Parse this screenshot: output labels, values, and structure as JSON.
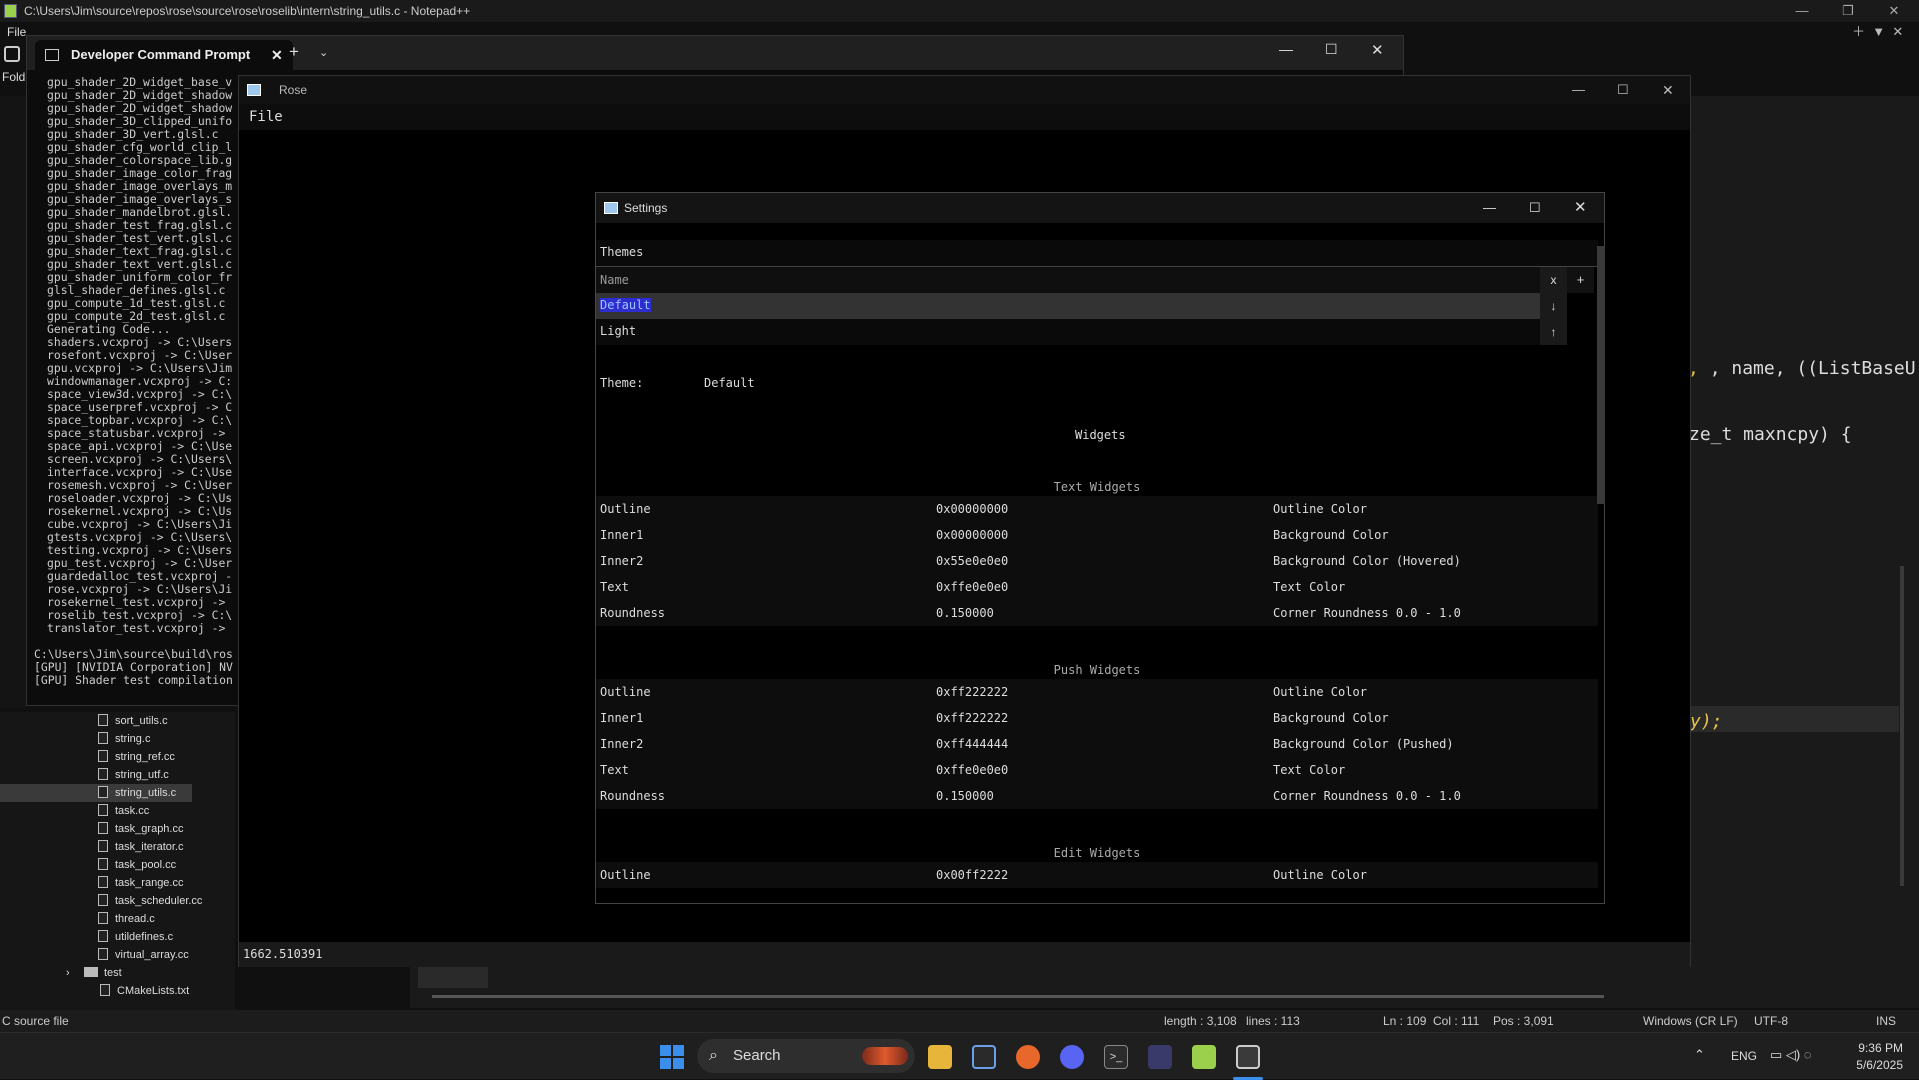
{
  "npp": {
    "title": "C:\\Users\\Jim\\source\\repos\\rose\\source\\rose\\roselib\\intern\\string_utils.c - Notepad++",
    "menu_file": "File",
    "folder_label": "Fold",
    "tree_items": [
      {
        "label": "sort_utils.c",
        "selected": false
      },
      {
        "label": "string.c",
        "selected": false
      },
      {
        "label": "string_ref.cc",
        "selected": false
      },
      {
        "label": "string_utf.c",
        "selected": false
      },
      {
        "label": "string_utils.c",
        "selected": true
      },
      {
        "label": "task.cc",
        "selected": false
      },
      {
        "label": "task_graph.cc",
        "selected": false
      },
      {
        "label": "task_iterator.c",
        "selected": false
      },
      {
        "label": "task_pool.cc",
        "selected": false
      },
      {
        "label": "task_range.cc",
        "selected": false
      },
      {
        "label": "task_scheduler.cc",
        "selected": false
      },
      {
        "label": "thread.c",
        "selected": false
      },
      {
        "label": "utildefines.c",
        "selected": false
      },
      {
        "label": "virtual_array.cc",
        "selected": false
      }
    ],
    "tree_folder": "test",
    "tree_cmake": "CMakeLists.txt",
    "code_line1": ", name, ((ListBaseU",
    "code_line2": "ze_t maxncpy) {",
    "code_line3": "y);",
    "status": {
      "file_type": "C source file",
      "length": "length : 3,108",
      "lines": "lines : 113",
      "ln": "Ln : 109",
      "col": "Col : 111",
      "pos": "Pos : 3,091",
      "eol": "Windows (CR LF)",
      "encoding": "UTF-8",
      "mode": "INS"
    }
  },
  "terminal": {
    "tab_title": "Developer Command Prompt",
    "lines": [
      "gpu_shader_2D_widget_base_v",
      "gpu_shader_2D_widget_shadow",
      "gpu_shader_2D_widget_shadow",
      "gpu_shader_3D_clipped_unifo",
      "gpu_shader_3D_vert.glsl.c",
      "gpu_shader_cfg_world_clip_l",
      "gpu_shader_colorspace_lib.g",
      "gpu_shader_image_color_frag",
      "gpu_shader_image_overlays_m",
      "gpu_shader_image_overlays_s",
      "gpu_shader_mandelbrot.glsl.",
      "gpu_shader_test_frag.glsl.c",
      "gpu_shader_test_vert.glsl.c",
      "gpu_shader_text_frag.glsl.c",
      "gpu_shader_text_vert.glsl.c",
      "gpu_shader_uniform_color_fr",
      "glsl_shader_defines.glsl.c",
      "gpu_compute_1d_test.glsl.c",
      "gpu_compute_2d_test.glsl.c",
      "Generating Code...",
      "shaders.vcxproj -> C:\\Users",
      "rosefont.vcxproj -> C:\\User",
      "gpu.vcxproj -> C:\\Users\\Jim",
      "windowmanager.vcxproj -> C:",
      "space_view3d.vcxproj -> C:\\",
      "space_userpref.vcxproj -> C",
      "space_topbar.vcxproj -> C:\\",
      "space_statusbar.vcxproj ->",
      "space_api.vcxproj -> C:\\Use",
      "screen.vcxproj -> C:\\Users\\",
      "interface.vcxproj -> C:\\Use",
      "rosemesh.vcxproj -> C:\\User",
      "roseloader.vcxproj -> C:\\Us",
      "rosekernel.vcxproj -> C:\\Us",
      "cube.vcxproj -> C:\\Users\\Ji",
      "gtests.vcxproj -> C:\\Users\\",
      "testing.vcxproj -> C:\\Users",
      "gpu_test.vcxproj -> C:\\User",
      "guardedalloc_test.vcxproj -",
      "rose.vcxproj -> C:\\Users\\Ji",
      "rosekernel_test.vcxproj ->",
      "roselib_test.vcxproj -> C:\\",
      "translator_test.vcxproj ->"
    ],
    "footer_lines": [
      "C:\\Users\\Jim\\source\\build\\ros",
      "[GPU] [NVIDIA Corporation] NV",
      "[GPU] Shader test compilation"
    ]
  },
  "rose": {
    "title": "Rose",
    "menu_file": "File",
    "status_value": "1662.510391"
  },
  "settings": {
    "title": "Settings",
    "themes_header": "Themes",
    "name_header": "Name",
    "btn_remove": "x",
    "btn_add": "+",
    "btn_down": "↓",
    "btn_up": "↑",
    "theme_list": [
      "Default",
      "Light"
    ],
    "theme_label": "Theme:",
    "theme_value": "Default",
    "widgets_header": "Widgets",
    "sections": [
      {
        "title": "Text Widgets",
        "rows": [
          {
            "name": "Outline",
            "value": "0x00000000",
            "desc": "Outline Color"
          },
          {
            "name": "Inner1",
            "value": "0x00000000",
            "desc": "Background Color"
          },
          {
            "name": "Inner2",
            "value": "0x55e0e0e0",
            "desc": "Background Color (Hovered)"
          },
          {
            "name": "Text",
            "value": "0xffe0e0e0",
            "desc": "Text Color"
          },
          {
            "name": "Roundness",
            "value": "0.150000",
            "desc": "Corner Roundness 0.0 - 1.0"
          }
        ]
      },
      {
        "title": "Push Widgets",
        "rows": [
          {
            "name": "Outline",
            "value": "0xff222222",
            "desc": "Outline Color"
          },
          {
            "name": "Inner1",
            "value": "0xff222222",
            "desc": "Background Color"
          },
          {
            "name": "Inner2",
            "value": "0xff444444",
            "desc": "Background Color (Pushed)"
          },
          {
            "name": "Text",
            "value": "0xffe0e0e0",
            "desc": "Text Color"
          },
          {
            "name": "Roundness",
            "value": "0.150000",
            "desc": "Corner Roundness 0.0 - 1.0"
          }
        ]
      },
      {
        "title": "Edit Widgets",
        "rows": [
          {
            "name": "Outline",
            "value": "0x00ff2222",
            "desc": "Outline Color"
          }
        ]
      }
    ]
  },
  "taskbar": {
    "search_label": "Search",
    "lang": "ENG",
    "time": "9:36 PM",
    "date": "5/6/2025"
  },
  "colors": {
    "selection": "#2d2dd0",
    "code_yellow": "#e8c34a",
    "accent": "#3b8eea"
  }
}
